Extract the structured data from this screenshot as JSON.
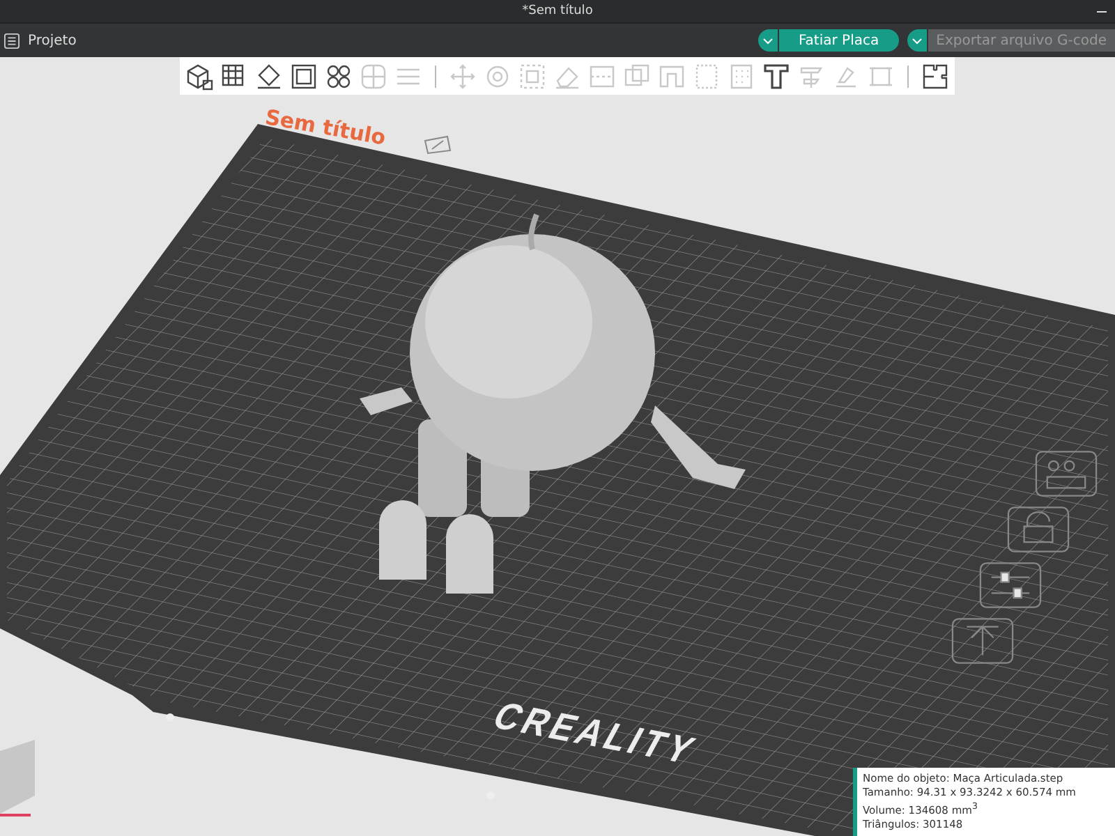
{
  "window": {
    "title": "*Sem título"
  },
  "menu": {
    "label": "Projeto"
  },
  "actions": [
    {
      "label": "Fatiar Placa",
      "disabled": false
    },
    {
      "label": "Exportar arquivo G-code",
      "disabled": true
    }
  ],
  "toolbar": [
    {
      "kind": "add",
      "disabled": false
    },
    {
      "kind": "plate",
      "disabled": false
    },
    {
      "kind": "orient",
      "disabled": false
    },
    {
      "kind": "arrange",
      "disabled": false
    },
    {
      "kind": "split",
      "disabled": false
    },
    {
      "kind": "parts",
      "disabled": true
    },
    {
      "kind": "layers",
      "disabled": true
    },
    {
      "kind": "sep"
    },
    {
      "kind": "move",
      "disabled": true
    },
    {
      "kind": "rotate",
      "disabled": true
    },
    {
      "kind": "scale",
      "disabled": true
    },
    {
      "kind": "erase",
      "disabled": true
    },
    {
      "kind": "cut",
      "disabled": true
    },
    {
      "kind": "boolean",
      "disabled": true
    },
    {
      "kind": "support",
      "disabled": true
    },
    {
      "kind": "seam",
      "disabled": true
    },
    {
      "kind": "fuzzy",
      "disabled": true
    },
    {
      "kind": "text",
      "disabled": false
    },
    {
      "kind": "measure",
      "disabled": true
    },
    {
      "kind": "assembly",
      "disabled": true
    },
    {
      "kind": "variable",
      "disabled": true
    },
    {
      "kind": "sep"
    },
    {
      "kind": "puzzle",
      "disabled": false
    }
  ],
  "plate": {
    "title": "Sem título",
    "logo": "CREALITY"
  },
  "info": [
    "Nome do objeto: Maça Articulada.step",
    "Tamanho: 94.31 x 93.3242 x 60.574 mm",
    "Volume: 134608 mm$^{3}$",
    "Triângulos: 301148"
  ]
}
